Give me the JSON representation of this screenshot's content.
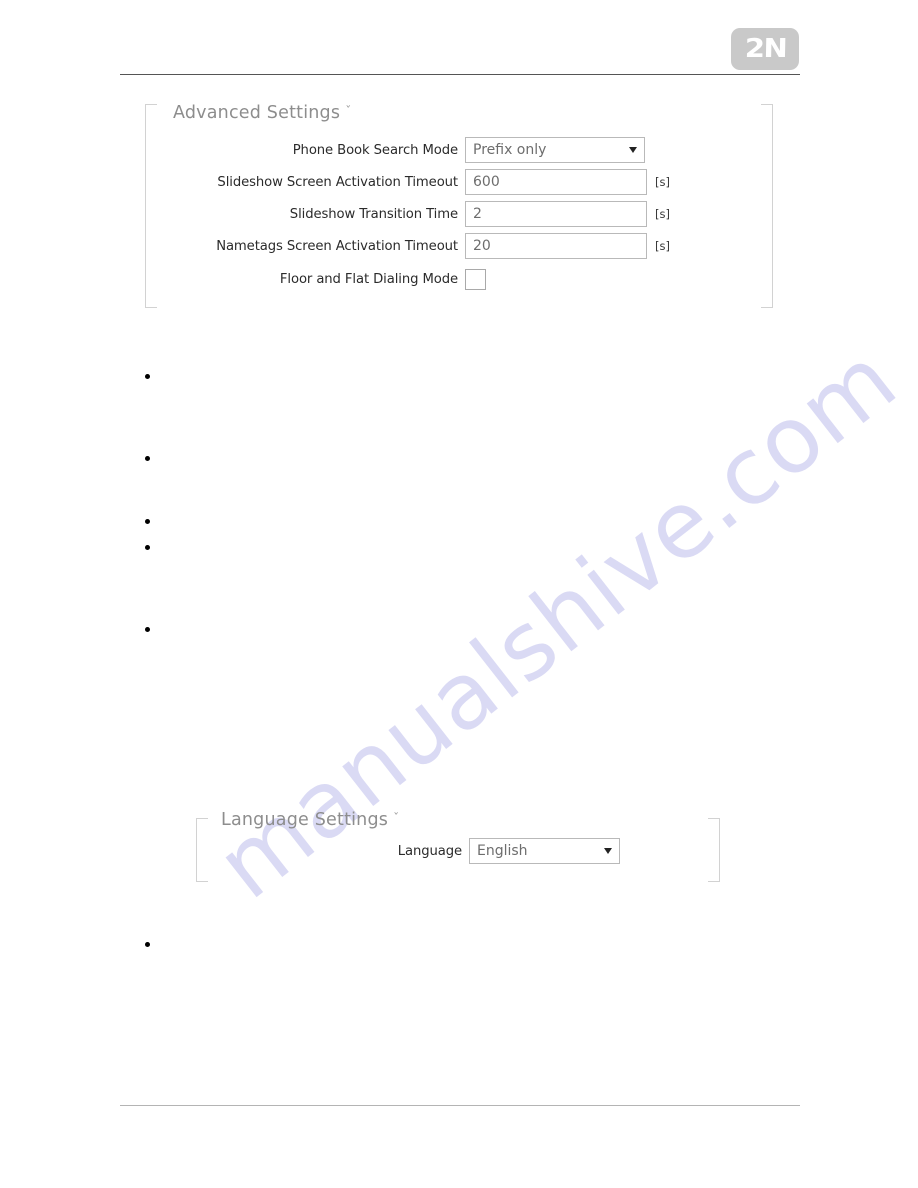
{
  "page": {
    "watermark_text": "manualshive.com",
    "logo_text": "2N",
    "chevron_glyph": "ˇ"
  },
  "advanced_settings": {
    "title": "Advanced Settings",
    "fields": [
      {
        "label": "Phone Book Search Mode",
        "type": "select",
        "value": "Prefix only",
        "unit": ""
      },
      {
        "label": "Slideshow Screen Activation Timeout",
        "type": "text",
        "value": "600",
        "unit": "[s]"
      },
      {
        "label": "Slideshow Transition Time",
        "type": "text",
        "value": "2",
        "unit": "[s]"
      },
      {
        "label": "Nametags Screen Activation Timeout",
        "type": "text",
        "value": "20",
        "unit": "[s]"
      },
      {
        "label": "Floor and Flat Dialing Mode",
        "type": "checkbox",
        "value": "",
        "unit": ""
      }
    ]
  },
  "language_settings": {
    "title": "Language Settings",
    "fields": [
      {
        "label": "Language",
        "type": "select",
        "value": "English",
        "unit": ""
      }
    ]
  }
}
